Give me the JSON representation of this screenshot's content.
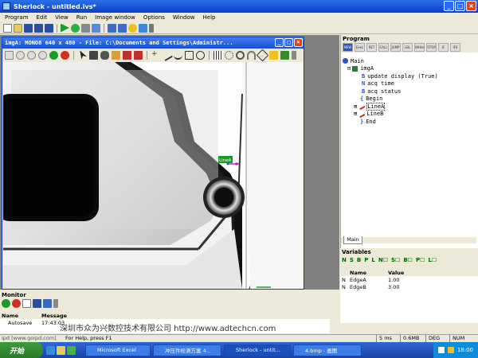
{
  "app": {
    "title": "Sherlock - untitled.ivs*",
    "window_buttons": [
      "_",
      "□",
      "×"
    ]
  },
  "menu": [
    "Program",
    "Edit",
    "View",
    "Run",
    "Image window",
    "Options",
    "Window",
    "Help"
  ],
  "image_window": {
    "title": "imgA: MONO8 640 x 480 - File: C:\\Documents and Settings\\Administr...",
    "roi_label": "LineA"
  },
  "program_panel": {
    "header": "Program",
    "toolbar": [
      "NEW",
      "Exec",
      "RET",
      "CALL",
      "JUMP",
      "LBL",
      "WHile",
      "STOP",
      "IF",
      "IFE"
    ],
    "tree": [
      {
        "label": "Main",
        "level": 0
      },
      {
        "label": "imgA",
        "level": 1
      },
      {
        "label": "update display (True)",
        "level": 2
      },
      {
        "label": "acq time",
        "level": 2
      },
      {
        "label": "acq status",
        "level": 2
      },
      {
        "label": "Begin",
        "level": 2
      },
      {
        "label": "LineA",
        "level": 2
      },
      {
        "label": "LineB",
        "level": 2
      },
      {
        "label": "End",
        "level": 2
      }
    ],
    "tab": "Main"
  },
  "variables_panel": {
    "header": "Variables",
    "tabs": [
      "N",
      "S",
      "B",
      "P",
      "L",
      "N☐",
      "S☐",
      "B☐",
      "P☐",
      "L☐"
    ],
    "columns": [
      "Name",
      "Value"
    ],
    "rows": [
      {
        "type": "N",
        "name": "EdgeA",
        "value": "1.00"
      },
      {
        "type": "N",
        "name": "EdgeB",
        "value": "3.00"
      }
    ]
  },
  "monitor": {
    "header": "Monitor",
    "columns": [
      "Name",
      "Message"
    ],
    "rows": [
      {
        "name": "Autosave",
        "message": "17:43:03"
      }
    ]
  },
  "watermark": "深圳市众为兴数控技术有限公司 http://www.adtechcn.com",
  "status": {
    "left": "For Help, press F1",
    "prefix": "ipd [www.goipd.com]",
    "ms": "5 ms",
    "mem": "0.6MB",
    "deg": "DEG",
    "num": "NUM"
  },
  "taskbar": {
    "start": "开始",
    "tasks": [
      "Microsoft Excel",
      "冲压件检测方案 4...",
      "Sherlock - untit...",
      "4.bmp - 画图"
    ],
    "clock": "18:00"
  }
}
